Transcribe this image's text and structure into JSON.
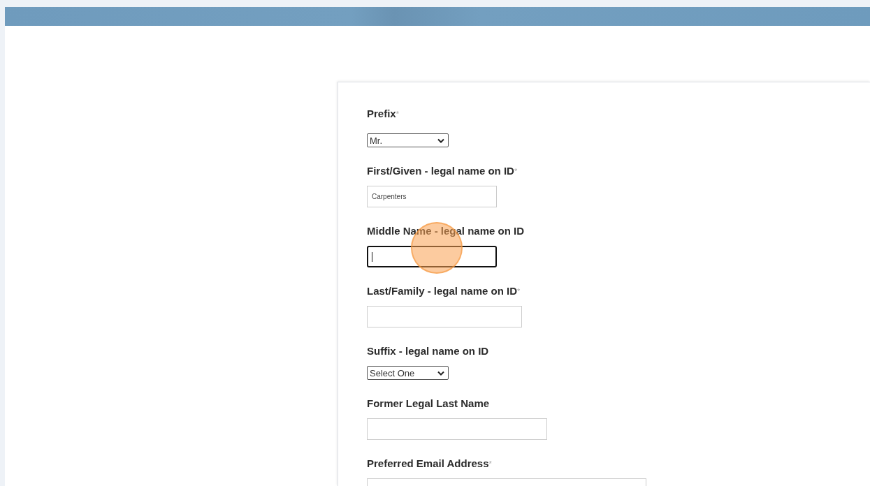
{
  "form": {
    "fields": [
      {
        "label": "Prefix",
        "mark": "*",
        "kind": "select",
        "value": "Mr."
      },
      {
        "label": "First/Given - legal name on ID",
        "mark": "*",
        "kind": "text",
        "value": "Carpenters"
      },
      {
        "label": "Middle Name - legal name on ID",
        "kind": "text",
        "focused": true,
        "clicked": true
      },
      {
        "label": "Last/Family - legal name on ID",
        "mark": "*",
        "kind": "text"
      },
      {
        "label": "Suffix - legal name on ID",
        "kind": "select",
        "value": "Select One"
      },
      {
        "label": "Former Legal Last Name",
        "kind": "text"
      },
      {
        "label": "Preferred Email Address",
        "mark": "*",
        "kind": "text"
      }
    ]
  }
}
